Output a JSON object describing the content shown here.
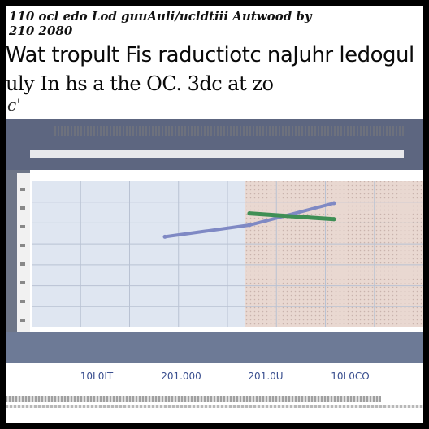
{
  "header": {
    "line1": "110 ocl edo Lod guuAuli/ucldtiii Autwood by",
    "line2": "210 2080"
  },
  "chart_data": {
    "type": "line",
    "title": "Wat tropult Fis raductiotс naJuhr ledogul",
    "subtitle": "uly In hs a the OC. 3dc at zo",
    "subtitle_tail": "c'",
    "x": [
      "10L0IT",
      "201.000",
      "201.0U",
      "10L0CO"
    ],
    "series": [
      {
        "values": [
          null,
          0.62,
          0.7,
          0.85
        ],
        "color": "#7f89c4"
      },
      {
        "values": [
          null,
          null,
          0.78,
          0.74
        ],
        "color": "#3f8f55"
      }
    ],
    "ylim": [
      0,
      1
    ],
    "grid": true,
    "colors": {
      "left_panel": "#dfe6f1",
      "right_panel": "#e9d8d1",
      "banner": "#5d6680",
      "axis_band": "#6d7a96"
    }
  }
}
